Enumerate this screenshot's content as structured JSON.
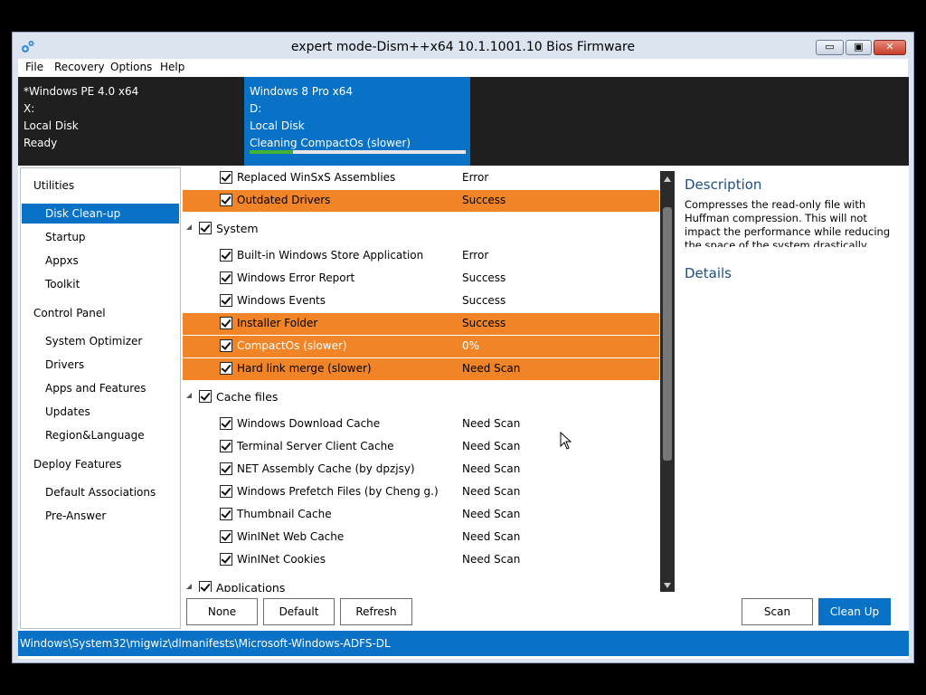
{
  "window": {
    "title": "expert mode-Dism++x64 10.1.1001.10 Bios Firmware",
    "controls": {
      "minimize": "▭",
      "maximize": "▣",
      "close": "✕"
    }
  },
  "menu": [
    "File",
    "Recovery",
    "Options",
    "Help"
  ],
  "images": [
    {
      "name": "*Windows PE 4.0 x64",
      "drive": "X:",
      "disk": "Local Disk",
      "state": "Ready",
      "active": false
    },
    {
      "name": "Windows 8 Pro x64",
      "drive": "D:",
      "disk": "Local Disk",
      "state": "Cleaning CompactOs (slower)",
      "active": true,
      "progress": 0.2
    }
  ],
  "nav": [
    {
      "label": "Utilities",
      "type": "cat"
    },
    {
      "label": "Disk Clean-up",
      "type": "sub",
      "selected": true
    },
    {
      "label": "Startup",
      "type": "sub"
    },
    {
      "label": "Appxs",
      "type": "sub"
    },
    {
      "label": "Toolkit",
      "type": "sub"
    },
    {
      "label": "Control Panel",
      "type": "cat"
    },
    {
      "label": "System Optimizer",
      "type": "sub"
    },
    {
      "label": "Drivers",
      "type": "sub"
    },
    {
      "label": "Apps and Features",
      "type": "sub"
    },
    {
      "label": "Updates",
      "type": "sub"
    },
    {
      "label": "Region&Language",
      "type": "sub"
    },
    {
      "label": "Deploy Features",
      "type": "cat"
    },
    {
      "label": "Default Associations",
      "type": "sub"
    },
    {
      "label": "Pre-Answer",
      "type": "sub"
    }
  ],
  "list": {
    "items": [
      {
        "name": "Replaced WinSxS Assemblies",
        "status": "Error"
      },
      {
        "name": "Outdated Drivers",
        "status": "Success",
        "highlight": true
      },
      {
        "name": "System",
        "status": "",
        "group": true
      },
      {
        "name": "Built-in Windows Store Application",
        "status": "Error"
      },
      {
        "name": "Windows Error Report",
        "status": "Success"
      },
      {
        "name": "Windows Events",
        "status": "Success"
      },
      {
        "name": "Installer Folder",
        "status": "Success",
        "highlight": true
      },
      {
        "name": "CompactOs (slower)",
        "status": "0%",
        "highlight": true,
        "compact": true
      },
      {
        "name": "Hard link merge (slower)",
        "status": "Need Scan",
        "highlight": true
      },
      {
        "name": "Cache files",
        "status": "",
        "group": true
      },
      {
        "name": "Windows Download Cache",
        "status": "Need Scan"
      },
      {
        "name": "Terminal Server Client Cache",
        "status": "Need Scan"
      },
      {
        "name": "NET Assembly Cache (by dpzjsy)",
        "status": "Need Scan"
      },
      {
        "name": "Windows Prefetch Files (by Cheng g.)",
        "status": "Need Scan"
      },
      {
        "name": "Thumbnail Cache",
        "status": "Need Scan"
      },
      {
        "name": "WinINet Web Cache",
        "status": "Need Scan"
      },
      {
        "name": "WinINet Cookies",
        "status": "Need Scan"
      },
      {
        "name": "Applications",
        "status": "",
        "group": true
      }
    ]
  },
  "description": {
    "title": "Description",
    "body": "Compresses the read-only file with Huffman compression. This will not impact the performance while reducing the space of the system drastically. Special thanks to the",
    "details_title": "Details"
  },
  "buttons": {
    "none": "None",
    "default": "Default",
    "refresh": "Refresh",
    "scan": "Scan",
    "cleanup": "Clean Up"
  },
  "statusbar": {
    "path": "Windows\\System32\\migwiz\\dlmanifests\\Microsoft-Windows-ADFS-DL"
  },
  "colors": {
    "accent": "#0a72c6",
    "highlight": "#f08427",
    "progress": "#41b336"
  }
}
